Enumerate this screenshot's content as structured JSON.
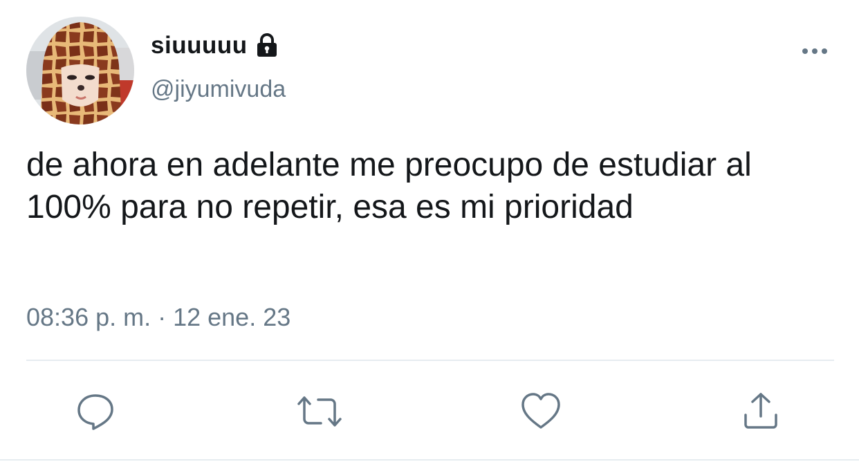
{
  "tweet": {
    "display_name": "siuuuuu",
    "handle": "@jiyumivuda",
    "text": "de ahora en adelante me preocupo de estudiar al 100% para no repetir, esa es mi prioridad",
    "timestamp": "08:36 p. m. · 12 ene. 23"
  },
  "icons": {
    "lock": "lock-icon",
    "more": "more-icon",
    "reply": "reply-icon",
    "retweet": "retweet-icon",
    "like": "heart-icon",
    "share": "share-icon"
  },
  "colors": {
    "text_primary": "#14171a",
    "text_secondary": "#657786",
    "divider": "#e6ecf0"
  }
}
